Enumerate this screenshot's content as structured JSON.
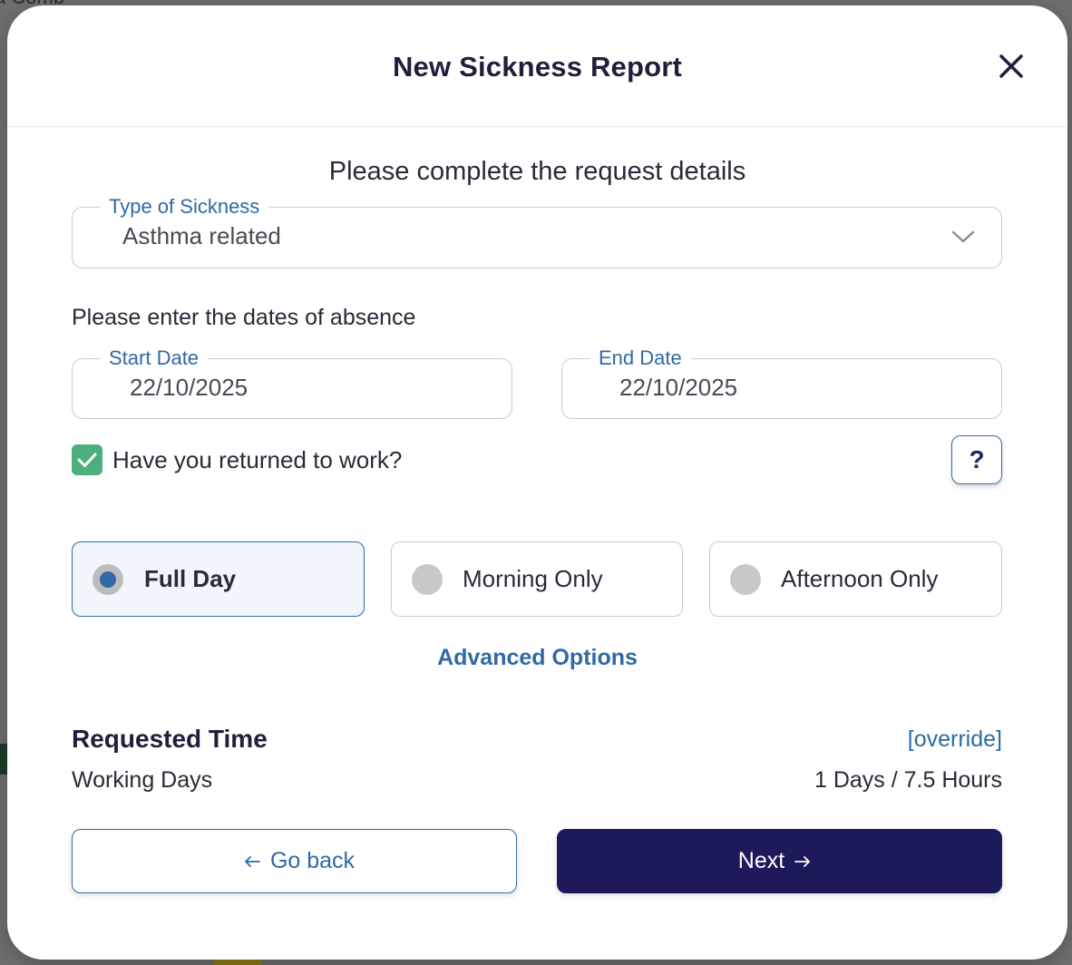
{
  "background": {
    "partial_text": "a Comb"
  },
  "modal": {
    "title": "New Sickness Report",
    "subtitle": "Please complete the request details"
  },
  "sickness_type": {
    "label": "Type of Sickness",
    "value": "Asthma related"
  },
  "dates": {
    "prompt": "Please enter the dates of absence",
    "start_label": "Start Date",
    "start_value": "22/10/2025",
    "end_label": "End Date",
    "end_value": "22/10/2025"
  },
  "returned": {
    "label": "Have you returned to work?",
    "checked": true
  },
  "help": {
    "label": "?"
  },
  "duration_options": [
    {
      "label": "Full Day",
      "selected": true
    },
    {
      "label": "Morning Only",
      "selected": false
    },
    {
      "label": "Afternoon Only",
      "selected": false
    }
  ],
  "advanced_options_label": "Advanced Options",
  "requested_time": {
    "title": "Requested Time",
    "override_label": "[override]",
    "row_label": "Working Days",
    "row_value": "1 Days / 7.5 Hours"
  },
  "buttons": {
    "back_label": "Go back",
    "next_label": "Next"
  },
  "colors": {
    "accent": "#2f6aa6",
    "primary_button": "#1c1a5a",
    "checkbox_green": "#4caf7d"
  }
}
